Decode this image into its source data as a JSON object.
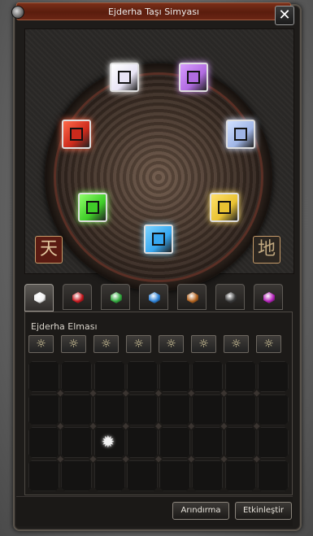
{
  "window": {
    "title": "Ejderha Taşı Simyası",
    "close_label": "✕"
  },
  "wheel": {
    "sockets": [
      {
        "name": "socket-diamond",
        "color": "#e8e4f5",
        "glow": "#ffffff"
      },
      {
        "name": "socket-amethyst",
        "color": "#b06be0",
        "glow": "#d79bff"
      },
      {
        "name": "socket-sapphire-light",
        "color": "#9fb5e6",
        "glow": "#d0e0ff"
      },
      {
        "name": "socket-topaz",
        "color": "#e8c232",
        "glow": "#ffe06a"
      },
      {
        "name": "socket-aquamarine",
        "color": "#36a7f0",
        "glow": "#7fd4ff"
      },
      {
        "name": "socket-jade",
        "color": "#3fcc28",
        "glow": "#8fff6a"
      },
      {
        "name": "socket-ruby",
        "color": "#cc2a1c",
        "glow": "#ff6a4a"
      }
    ],
    "heaven_glyph": "天",
    "earth_glyph": "地"
  },
  "tabs": [
    {
      "name": "tab-diamond",
      "color": "#f0f0f0"
    },
    {
      "name": "tab-ruby",
      "color": "#c4161c"
    },
    {
      "name": "tab-jade",
      "color": "#2fa73c"
    },
    {
      "name": "tab-sapphire",
      "color": "#2a7fd4"
    },
    {
      "name": "tab-garnet",
      "color": "#b0601c"
    },
    {
      "name": "tab-onyx",
      "color": "#3a3a3a"
    },
    {
      "name": "tab-amethyst",
      "color": "#b21fb8"
    }
  ],
  "section": {
    "label": "Ejderha Elması",
    "grade_icons": [
      "☼",
      "☼",
      "☼",
      "☼",
      "☼",
      "☼",
      "☼",
      "☼"
    ]
  },
  "inventory": {
    "occupied_icon": "✹"
  },
  "buttons": {
    "refine": "Arındırma",
    "activate": "Etkinleştir"
  }
}
